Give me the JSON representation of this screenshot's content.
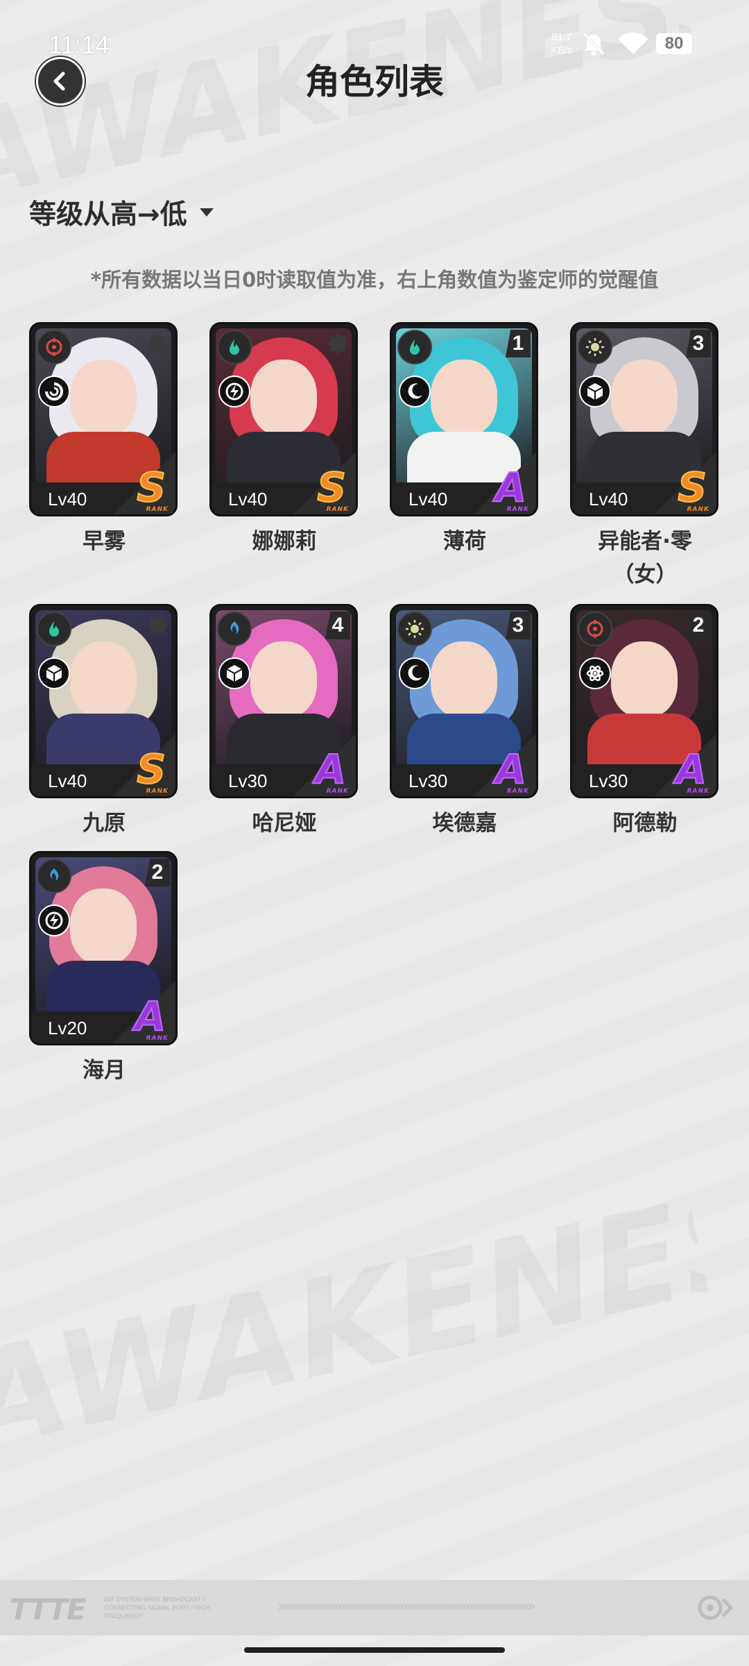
{
  "status_bar": {
    "time": "11:14",
    "net_speed_value": "81.7",
    "net_speed_unit": "KB/s",
    "battery": "80"
  },
  "header": {
    "title": "角色列表",
    "back_icon": "chevron-left-icon"
  },
  "sort": {
    "label": "等级从高→低"
  },
  "notice": "*所有数据以当日0时读取值为准，右上角数值为鉴定师的觉醒值",
  "characters": [
    {
      "name": "早雾",
      "level": "Lv40",
      "rank": "S",
      "rank_word": "RANK",
      "awakening": "",
      "element": "target",
      "element_color": "#e04848",
      "class": "spiral",
      "hair": "#e9e9ef",
      "outfit": "#c0392b",
      "bg": "#4a4a55"
    },
    {
      "name": "娜娜莉",
      "level": "Lv40",
      "rank": "S",
      "rank_word": "RANK",
      "awakening": "",
      "element": "flame",
      "element_color": "#2fc6a1",
      "class": "bolt",
      "hair": "#d63a4f",
      "outfit": "#2c2c34",
      "bg": "#5a2a35"
    },
    {
      "name": "薄荷",
      "level": "Lv40",
      "rank": "A",
      "rank_word": "RANK",
      "awakening": "1",
      "element": "flame",
      "element_color": "#2fc6a1",
      "class": "moon",
      "hair": "#3fc6d6",
      "outfit": "#f2f2f2",
      "bg": "#6fd0d8"
    },
    {
      "name": "异能者·零",
      "name_line2": "（女）",
      "level": "Lv40",
      "rank": "S",
      "rank_word": "RANK",
      "awakening": "3",
      "element": "sun",
      "element_color": "#d9d9a0",
      "class": "cube",
      "hair": "#c9c9cf",
      "outfit": "#2f2f36",
      "bg": "#5c5c64"
    },
    {
      "name": "九原",
      "level": "Lv40",
      "rank": "S",
      "rank_word": "RANK",
      "awakening": "",
      "element": "flame",
      "element_color": "#2fc6a1",
      "class": "cube",
      "hair": "#d8d2c2",
      "outfit": "#3a3a6a",
      "bg": "#3c3a5a"
    },
    {
      "name": "哈尼娅",
      "level": "Lv30",
      "rank": "A",
      "rank_word": "RANK",
      "awakening": "4",
      "element": "wave",
      "element_color": "#3a9be0",
      "class": "cube",
      "hair": "#e56bc0",
      "outfit": "#2a2a30",
      "bg": "#7a4a6a"
    },
    {
      "name": "埃德嘉",
      "level": "Lv30",
      "rank": "A",
      "rank_word": "RANK",
      "awakening": "3",
      "element": "sun",
      "element_color": "#d9d9a0",
      "class": "moon",
      "hair": "#6f9ad8",
      "outfit": "#2a4a8a",
      "bg": "#4a5a7a"
    },
    {
      "name": "阿德勒",
      "level": "Lv30",
      "rank": "A",
      "rank_word": "RANK",
      "awakening": "2",
      "element": "target",
      "element_color": "#e04848",
      "class": "atom",
      "hair": "#5a2a3a",
      "outfit": "#c83a3a",
      "bg": "#3a2a2a"
    },
    {
      "name": "海月",
      "level": "Lv20",
      "rank": "A",
      "rank_word": "RANK",
      "awakening": "2",
      "element": "wave",
      "element_color": "#3a9be0",
      "class": "bolt",
      "hair": "#e27a9a",
      "outfit": "#2a2a5a",
      "bg": "#4a4a7a"
    }
  ],
  "banner": {
    "logo": "TTTE",
    "small_text": "INT SYSTEM WAVE BROADCAST / CONNECTING SIGNAL PORT / HIGH FREQUENCY",
    "arrows": "»»»»»»»»»»»»»»»»»»»»»»»»»»»»»»»»»»»»»»»"
  },
  "colors": {
    "rank_S": "#f08a2a",
    "rank_A": "#9b38d9",
    "background": "#ececec"
  }
}
